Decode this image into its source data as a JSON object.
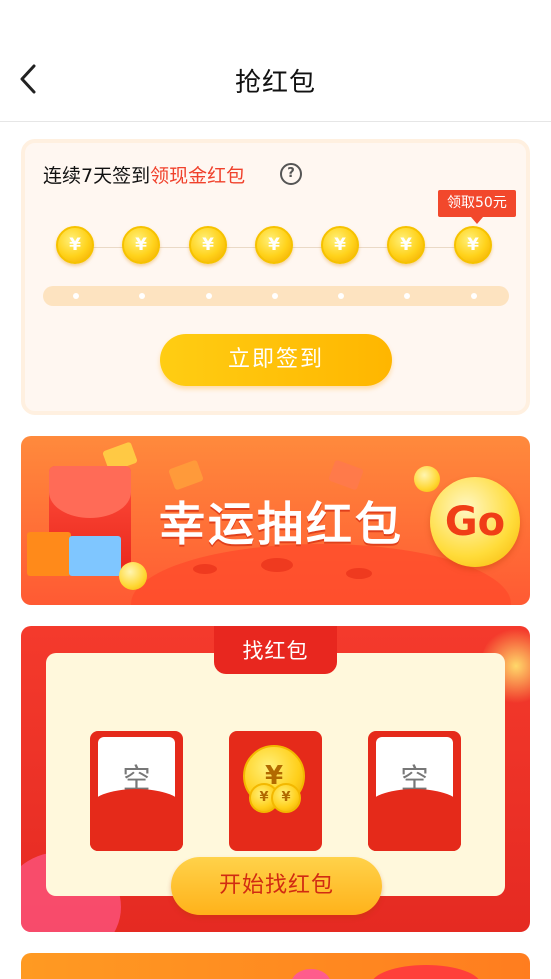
{
  "header": {
    "title": "抢红包",
    "back_icon": "chevron-left-icon"
  },
  "signin": {
    "title_prefix": "连续7天签到",
    "title_highlight": "领现金红包",
    "help_symbol": "?",
    "reward_tag": "领取50元",
    "coin_symbol": "¥",
    "day_count": 7,
    "checked_in_days": 0,
    "button_label": "立即签到",
    "highlight_color": "#f0412c",
    "button_color": "#ffc10a"
  },
  "lucky": {
    "title": "幸运抽红包",
    "go_label": "Go"
  },
  "find": {
    "tab_label": "找红包",
    "packets": [
      {
        "state": "empty",
        "label": "空"
      },
      {
        "state": "coins",
        "label": "¥"
      },
      {
        "state": "empty",
        "label": "空"
      }
    ],
    "start_button": "开始找红包"
  }
}
